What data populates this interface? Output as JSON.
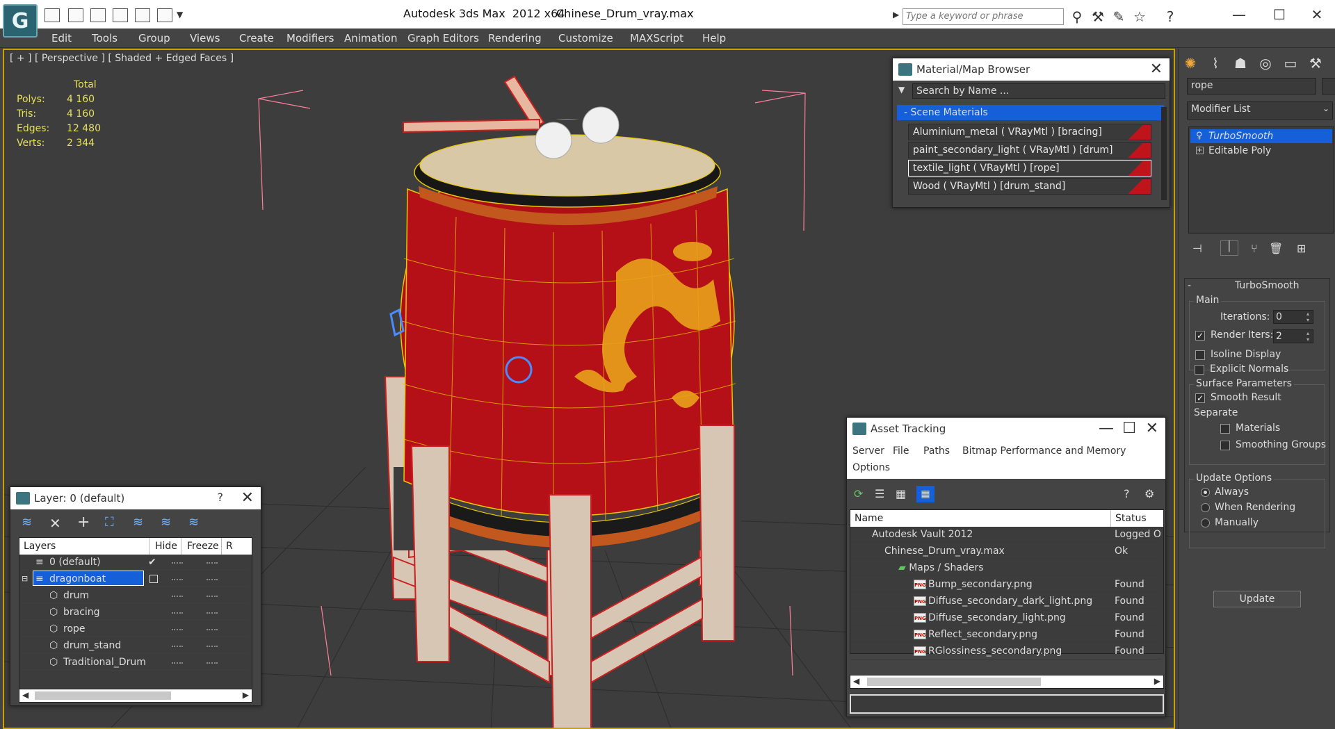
{
  "window": {
    "app_title": "Autodesk 3ds Max  2012 x64",
    "file_title": "Chinese_Drum_vray.max",
    "search_placeholder": "Type a keyword or phrase",
    "logo": "G"
  },
  "menu": [
    "Edit",
    "Tools",
    "Group",
    "Views",
    "Create",
    "Modifiers",
    "Animation",
    "Graph Editors",
    "Rendering",
    "Customize",
    "MAXScript",
    "Help"
  ],
  "viewport": {
    "label": "[ + ] [ Perspective ] [ Shaded + Edged Faces ]",
    "stats": {
      "header": "Total",
      "rows": [
        {
          "k": "Polys:",
          "v": "4 160"
        },
        {
          "k": "Tris:",
          "v": "4 160"
        },
        {
          "k": "Edges:",
          "v": "12 480"
        },
        {
          "k": "Verts:",
          "v": "2 344"
        }
      ]
    }
  },
  "command_panel": {
    "name_value": "rope",
    "modifier_list": "Modifier List",
    "stack": [
      "TurboSmooth",
      "Editable Poly"
    ],
    "turbosmooth": {
      "title": "TurboSmooth",
      "main": "Main",
      "iterations_label": "Iterations:",
      "iterations": "0",
      "render_iters_label": "Render Iters:",
      "render_iters": "2",
      "isoline": "Isoline Display",
      "explicit": "Explicit Normals",
      "surface": "Surface Parameters",
      "smooth_result": "Smooth Result",
      "separate": "Separate",
      "materials": "Materials",
      "smoothing_groups": "Smoothing Groups",
      "update_options": "Update Options",
      "always": "Always",
      "when_rendering": "When Rendering",
      "manually": "Manually",
      "update_btn": "Update"
    }
  },
  "material_browser": {
    "title": "Material/Map Browser",
    "search_placeholder": "Search by Name ...",
    "group": "Scene Materials",
    "items": [
      "Aluminium_metal  ( VRayMtl ) [bracing]",
      "paint_secondary_light  ( VRayMtl ) [drum]",
      "textile_light  ( VRayMtl ) [rope]",
      "Wood  ( VRayMtl ) [drum_stand]"
    ]
  },
  "asset_tracking": {
    "title": "Asset Tracking",
    "menu": [
      "Server",
      "File",
      "Paths",
      "Bitmap Performance and Memory",
      "Options"
    ],
    "col_name": "Name",
    "col_status": "Status",
    "rows": [
      {
        "name": "Autodesk Vault 2012",
        "status": "Logged O"
      },
      {
        "name": "Chinese_Drum_vray.max",
        "status": "Ok"
      },
      {
        "name": "Maps / Shaders",
        "status": ""
      },
      {
        "name": "Bump_secondary.png",
        "status": "Found"
      },
      {
        "name": "Diffuse_secondary_dark_light.png",
        "status": "Found"
      },
      {
        "name": "Diffuse_secondary_light.png",
        "status": "Found"
      },
      {
        "name": "Reflect_secondary.png",
        "status": "Found"
      },
      {
        "name": "RGlossiness_secondary.png",
        "status": "Found"
      }
    ],
    "png_badge": "PNG"
  },
  "layer_dialog": {
    "title": "Layer: 0 (default)",
    "help": "?",
    "col_layers": "Layers",
    "col_hide": "Hide",
    "col_freeze": "Freeze",
    "col_r": "R",
    "rows": [
      "0 (default)",
      "dragonboat",
      "drum",
      "bracing",
      "rope",
      "drum_stand",
      "Traditional_Drum"
    ]
  },
  "colors": {
    "selection_blue": "#1560d8",
    "active_border": "#c9a100",
    "drum_red": "#c0141c",
    "dragon_gold": "#e8a21a"
  }
}
